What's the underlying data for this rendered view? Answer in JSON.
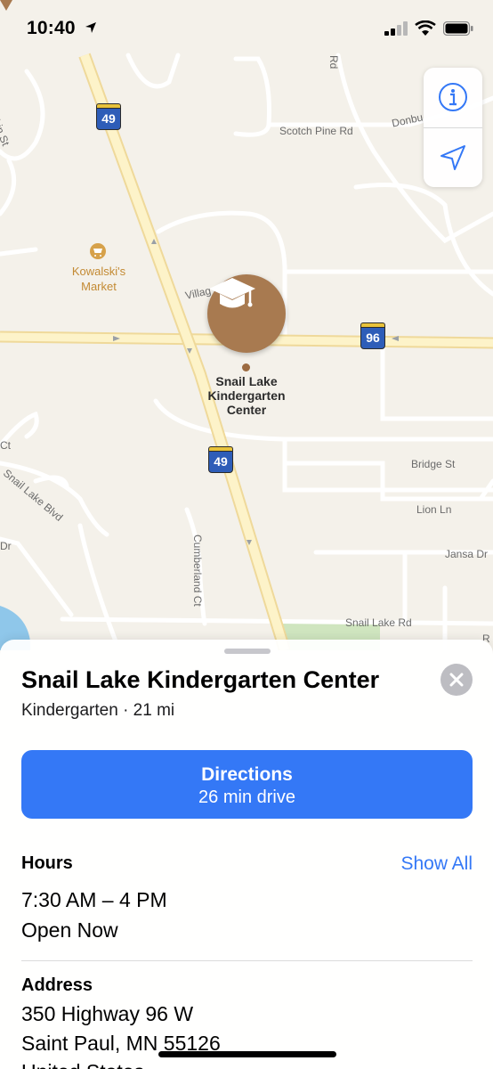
{
  "status_bar": {
    "time": "10:40"
  },
  "map": {
    "route_shields": [
      "49",
      "96",
      "49"
    ],
    "roads": {
      "scotch_pine": "Scotch Pine Rd",
      "donbu": "Donbu",
      "rd_top": "Rd",
      "st_left": "hin St",
      "village": "Villag",
      "ct_left": "Ct",
      "snail_lake_blvd": "Snail Lake Blvd",
      "dr_left": "Dr",
      "bridge": "Bridge St",
      "lion": "Lion Ln",
      "jansa": "Jansa Dr",
      "cumberland": "Cumberland Ct",
      "snail_lake_rd": "Snail Lake Rd",
      "r_right": "R"
    },
    "poi": {
      "line1": "Kowalski's",
      "line2": "Market"
    },
    "selected_place": {
      "line1": "Snail Lake",
      "line2": "Kindergarten",
      "line3": "Center"
    },
    "controls": {
      "info_icon": "info-icon",
      "location_icon": "location-arrow-icon"
    }
  },
  "sheet": {
    "title": "Snail Lake Kindergarten Center",
    "subtitle": "Kindergarten · 21 mi",
    "directions": {
      "label": "Directions",
      "sub": "26 min drive"
    },
    "hours": {
      "heading": "Hours",
      "show_all": "Show All",
      "range": "7:30 AM – 4 PM",
      "status": "Open Now"
    },
    "address": {
      "heading": "Address",
      "line1": "350 Highway 96 W",
      "line2": "Saint Paul, MN  55126",
      "line3": "United States"
    }
  },
  "colors": {
    "accent": "#3478f6",
    "pin": "#a87a50",
    "poi": "#c38a33",
    "shield_blue": "#2e5db8",
    "shield_yellow": "#e8c23a"
  }
}
